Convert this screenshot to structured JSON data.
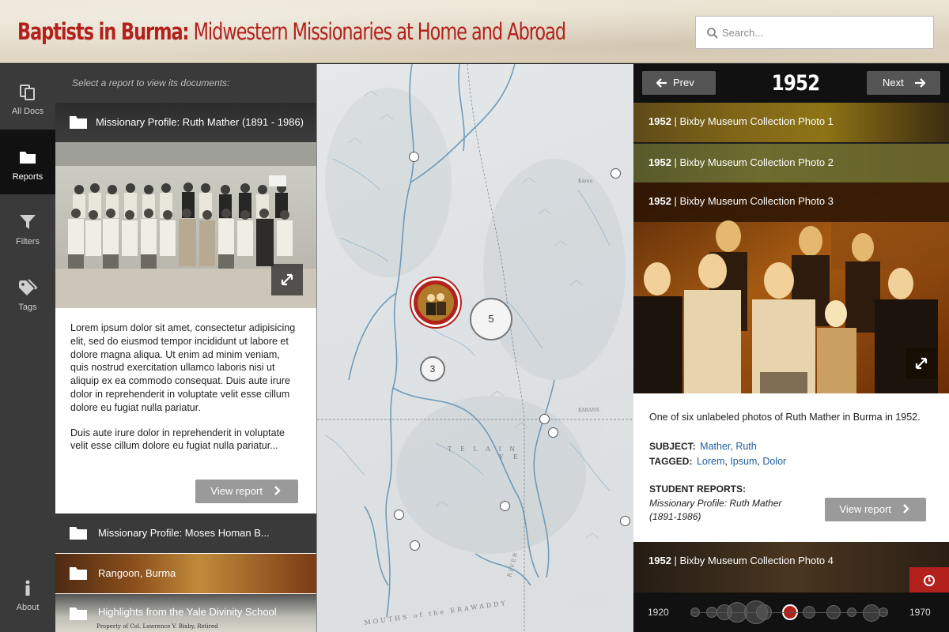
{
  "header": {
    "title_main": "Baptists in Burma:",
    "title_sub": " Midwestern Missionaries at Home and Abroad",
    "search_placeholder": "Search..."
  },
  "nav": {
    "items": [
      {
        "label": "All Docs",
        "icon": "documents-icon"
      },
      {
        "label": "Reports",
        "icon": "folder-icon"
      },
      {
        "label": "Filters",
        "icon": "funnel-icon"
      },
      {
        "label": "Tags",
        "icon": "tags-icon"
      }
    ],
    "about_label": "About"
  },
  "reports": {
    "hint": "Select a report to view its documents:",
    "active": {
      "title": "Missionary Profile: Ruth Mather (1891 - 1986)",
      "paragraph1": "Lorem ipsum dolor sit amet, consectetur adipisicing elit, sed do eiusmod tempor incididunt ut labore et dolore magna aliqua. Ut enim ad minim veniam, quis nostrud exercitation ullamco laboris nisi ut aliquip ex ea commodo consequat. Duis aute irure dolor in reprehenderit in voluptate velit esse cillum dolore eu fugiat nulla pariatur.",
      "paragraph2": "Duis aute irure dolor in reprehenderit in voluptate velit esse cillum dolore eu fugiat nulla pariatur...",
      "button": "View report"
    },
    "others": [
      "Missionary Profile: Moses Homan B...",
      "Rangoon, Burma",
      "Highlights from the Yale Divinity School"
    ],
    "caption_fragment": "Property of Col. Lawrence V. Bixby, Retired"
  },
  "map": {
    "clusters": [
      "5",
      "3"
    ]
  },
  "detail": {
    "prev": "Prev",
    "next": "Next",
    "year": "1952",
    "rows": [
      {
        "year": "1952",
        "title": " | Bixby Museum Collection Photo 1"
      },
      {
        "year": "1952",
        "title": " | Bixby Museum Collection Photo 2"
      },
      {
        "year": "1952",
        "title": " | Bixby Museum Collection Photo 3"
      },
      {
        "year": "1952",
        "title": " | Bixby Museum Collection Photo 4"
      }
    ],
    "description": "One of six unlabeled photos of Ruth Mather in Burma in 1952.",
    "subject_label": "SUBJECT:",
    "subject_value": "Mather, Ruth",
    "tagged_label": "TAGGED:",
    "tags": [
      "Lorem",
      "Ipsum",
      "Dolor"
    ],
    "tag_separator": ", ",
    "student_reports_label": "STUDENT REPORTS:",
    "student_report_title": "Missionary Profile: Ruth Mather (1891-1986)",
    "view_report": "View report",
    "timeline_start": "1920",
    "timeline_end": "1970"
  },
  "colors": {
    "brand_red": "#b3211c",
    "link_blue": "#1f5d9e"
  }
}
